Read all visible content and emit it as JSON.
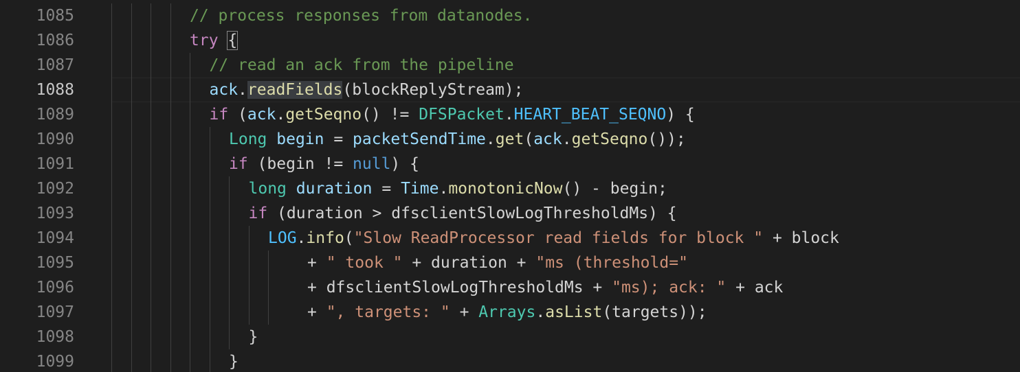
{
  "editor": {
    "active_line": "1088",
    "lines": [
      {
        "num": "1085",
        "indent_guides": 4,
        "indent": 4,
        "tokens": [
          {
            "t": "// process responses from datanodes.",
            "c": "cmt"
          }
        ]
      },
      {
        "num": "1086",
        "indent_guides": 4,
        "indent": 4,
        "tokens": [
          {
            "t": "try",
            "c": "kw"
          },
          {
            "t": " ",
            "c": "pl"
          },
          {
            "t": "{",
            "c": "pl bracket-box"
          }
        ]
      },
      {
        "num": "1087",
        "indent_guides": 5,
        "indent": 5,
        "tokens": [
          {
            "t": "// read an ack from the pipeline",
            "c": "cmt"
          }
        ]
      },
      {
        "num": "1088",
        "indent_guides": 5,
        "indent": 5,
        "tokens": [
          {
            "t": "ack",
            "c": "var"
          },
          {
            "t": ".",
            "c": "pl"
          },
          {
            "t": "readFields",
            "c": "fn hl"
          },
          {
            "t": "(blockReplyStream);",
            "c": "pl"
          }
        ]
      },
      {
        "num": "1089",
        "indent_guides": 5,
        "indent": 5,
        "tokens": [
          {
            "t": "if",
            "c": "kw"
          },
          {
            "t": " (",
            "c": "pl"
          },
          {
            "t": "ack",
            "c": "var"
          },
          {
            "t": ".",
            "c": "pl"
          },
          {
            "t": "getSeqno",
            "c": "fn"
          },
          {
            "t": "() != ",
            "c": "pl"
          },
          {
            "t": "DFSPacket",
            "c": "ty"
          },
          {
            "t": ".",
            "c": "pl"
          },
          {
            "t": "HEART_BEAT_SEQNO",
            "c": "cst"
          },
          {
            "t": ") {",
            "c": "pl"
          }
        ]
      },
      {
        "num": "1090",
        "indent_guides": 6,
        "indent": 6,
        "tokens": [
          {
            "t": "Long",
            "c": "ty"
          },
          {
            "t": " ",
            "c": "pl"
          },
          {
            "t": "begin",
            "c": "var"
          },
          {
            "t": " = ",
            "c": "pl"
          },
          {
            "t": "packetSendTime",
            "c": "var"
          },
          {
            "t": ".",
            "c": "pl"
          },
          {
            "t": "get",
            "c": "fn"
          },
          {
            "t": "(",
            "c": "pl"
          },
          {
            "t": "ack",
            "c": "var"
          },
          {
            "t": ".",
            "c": "pl"
          },
          {
            "t": "getSeqno",
            "c": "fn"
          },
          {
            "t": "());",
            "c": "pl"
          }
        ]
      },
      {
        "num": "1091",
        "indent_guides": 6,
        "indent": 6,
        "tokens": [
          {
            "t": "if",
            "c": "kw"
          },
          {
            "t": " (begin != ",
            "c": "pl"
          },
          {
            "t": "null",
            "c": "kw2"
          },
          {
            "t": ") {",
            "c": "pl"
          }
        ]
      },
      {
        "num": "1092",
        "indent_guides": 7,
        "indent": 7,
        "tokens": [
          {
            "t": "long",
            "c": "ty"
          },
          {
            "t": " ",
            "c": "pl"
          },
          {
            "t": "duration",
            "c": "var"
          },
          {
            "t": " = ",
            "c": "pl"
          },
          {
            "t": "Time",
            "c": "var"
          },
          {
            "t": ".",
            "c": "pl"
          },
          {
            "t": "monotonicNow",
            "c": "fn"
          },
          {
            "t": "() - begin;",
            "c": "pl"
          }
        ]
      },
      {
        "num": "1093",
        "indent_guides": 7,
        "indent": 7,
        "tokens": [
          {
            "t": "if",
            "c": "kw"
          },
          {
            "t": " (duration > dfsclientSlowLogThresholdMs) {",
            "c": "pl"
          }
        ]
      },
      {
        "num": "1094",
        "indent_guides": 8,
        "indent": 8,
        "tokens": [
          {
            "t": "LOG",
            "c": "cst"
          },
          {
            "t": ".",
            "c": "pl"
          },
          {
            "t": "info",
            "c": "fn"
          },
          {
            "t": "(",
            "c": "pl"
          },
          {
            "t": "\"Slow ReadProcessor read fields for block \"",
            "c": "str"
          },
          {
            "t": " + block",
            "c": "pl"
          }
        ]
      },
      {
        "num": "1095",
        "indent_guides": 9,
        "indent": 10,
        "tokens": [
          {
            "t": "+ ",
            "c": "pl"
          },
          {
            "t": "\" took \"",
            "c": "str"
          },
          {
            "t": " + duration + ",
            "c": "pl"
          },
          {
            "t": "\"ms (threshold=\"",
            "c": "str"
          }
        ]
      },
      {
        "num": "1096",
        "indent_guides": 9,
        "indent": 10,
        "tokens": [
          {
            "t": "+ dfsclientSlowLogThresholdMs + ",
            "c": "pl"
          },
          {
            "t": "\"ms); ack: \"",
            "c": "str"
          },
          {
            "t": " + ack",
            "c": "pl"
          }
        ]
      },
      {
        "num": "1097",
        "indent_guides": 9,
        "indent": 10,
        "tokens": [
          {
            "t": "+ ",
            "c": "pl"
          },
          {
            "t": "\", targets: \"",
            "c": "str"
          },
          {
            "t": " + ",
            "c": "pl"
          },
          {
            "t": "Arrays",
            "c": "ty"
          },
          {
            "t": ".",
            "c": "pl"
          },
          {
            "t": "asList",
            "c": "fn"
          },
          {
            "t": "(targets));",
            "c": "pl"
          }
        ]
      },
      {
        "num": "1098",
        "indent_guides": 7,
        "indent": 7,
        "tokens": [
          {
            "t": "}",
            "c": "pl"
          }
        ]
      },
      {
        "num": "1099",
        "indent_guides": 6,
        "indent": 6,
        "tokens": [
          {
            "t": "}",
            "c": "pl"
          }
        ]
      }
    ]
  }
}
